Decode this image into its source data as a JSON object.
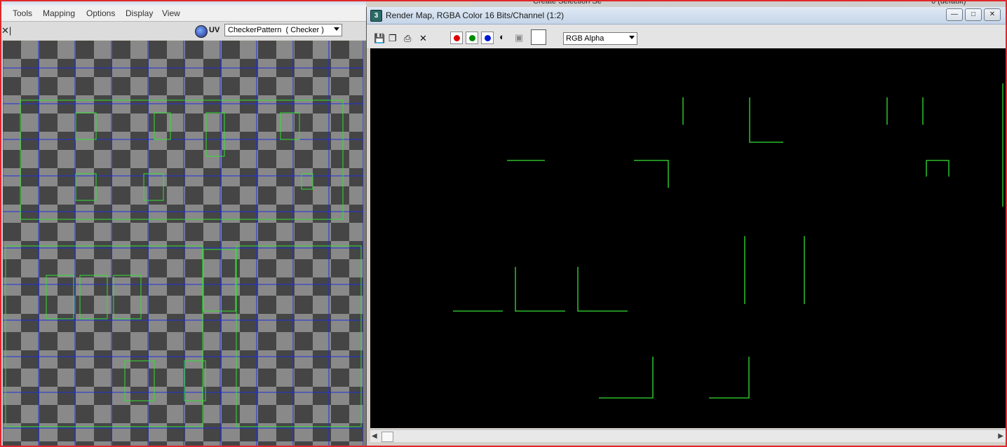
{
  "uv_editor": {
    "menu": [
      "Tools",
      "Mapping",
      "Options",
      "Display",
      "View"
    ],
    "uv_label": "UV",
    "map_select": "CheckerPattern  ( Checker )"
  },
  "render_window": {
    "title": "Render Map, RGBA Color 16 Bits/Channel (1:2)",
    "controls": {
      "minimize": "—",
      "maximize": "□",
      "close": "✕"
    },
    "toolbar_icons": [
      "save-icon",
      "copy-icon",
      "print-icon",
      "clear-icon"
    ],
    "channel_buttons": [
      {
        "name": "red-channel",
        "color": "#e00000"
      },
      {
        "name": "green-channel",
        "color": "#008a00"
      },
      {
        "name": "blue-channel",
        "color": "#0018d8"
      }
    ],
    "channel_select": "RGB Alpha"
  },
  "background_app": {
    "text_left": "Create Selection Se",
    "text_right": "0 (default)"
  },
  "colors": {
    "uv_lines": "#33e033",
    "grid_lines": "#1e2fd9",
    "checker_light": "#898989",
    "checker_dark": "#454545",
    "window_border": "#e0282a"
  }
}
